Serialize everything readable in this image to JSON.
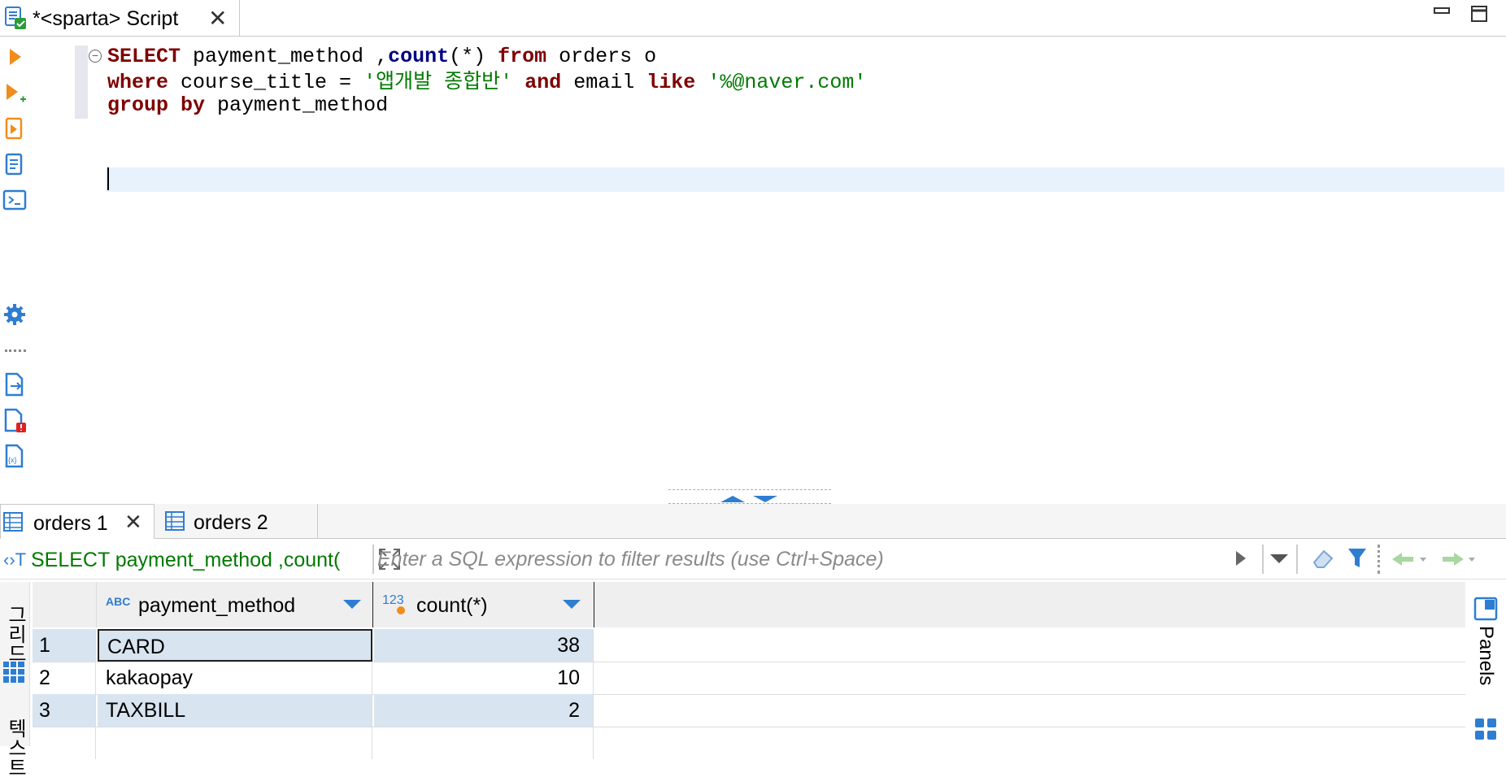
{
  "script_tab": {
    "title": "*<sparta> Script"
  },
  "editor": {
    "line1": {
      "kw_select": "SELECT",
      "t1": " payment_method ,",
      "fn_count": "count",
      "t2": "(*) ",
      "kw_from": "from",
      "t3": " orders o"
    },
    "line2": {
      "kw_where": "where",
      "t1": " course_title = ",
      "s1": "'앱개발 종합반'",
      "t2": " ",
      "kw_and": "and",
      "t3": " email ",
      "kw_like": "like",
      "t4": " ",
      "s2": "'%@naver.com'"
    },
    "line3": {
      "kw_group_by": "group by",
      "t1": " payment_method"
    }
  },
  "results_tabs": [
    {
      "label": "orders 1"
    },
    {
      "label": "orders 2"
    }
  ],
  "filter": {
    "query_preview": "SELECT payment_method ,count(",
    "placeholder": "Enter a SQL expression to filter results (use Ctrl+Space)"
  },
  "grid": {
    "columns": [
      {
        "type_badge": "ABC",
        "name": "payment_method"
      },
      {
        "type_badge": "123",
        "name": "count(*)"
      }
    ],
    "rows": [
      {
        "num": "1",
        "payment_method": "CARD",
        "count": "38"
      },
      {
        "num": "2",
        "payment_method": "kakaopay",
        "count": "10"
      },
      {
        "num": "3",
        "payment_method": "TAXBILL",
        "count": "2"
      }
    ]
  },
  "side": {
    "grid_label": "그리드",
    "text_label": "텍스트",
    "panels_label": "Panels"
  },
  "colors": {
    "keyword": "#7f0000",
    "string": "#007a00",
    "function": "#000080",
    "accent_blue": "#2e7dd1",
    "current_line": "#e8f2fc",
    "selected_cell": "#d8e4f0"
  }
}
